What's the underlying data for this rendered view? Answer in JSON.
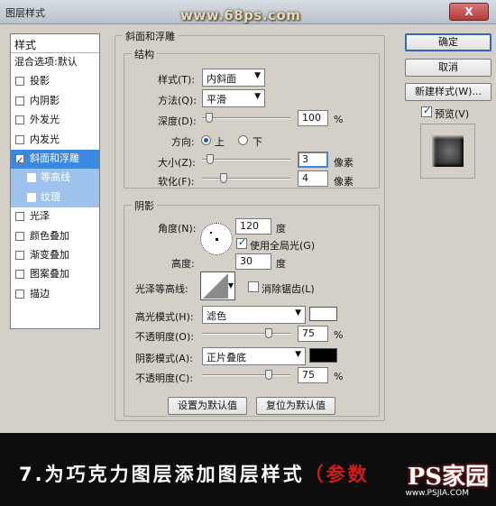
{
  "window": {
    "title": "图层样式",
    "watermark": "www.68ps.com",
    "close_label": "X"
  },
  "styles_panel": {
    "header": "样式",
    "blend_options": "混合选项:默认",
    "items": [
      {
        "label": "投影",
        "checked": false
      },
      {
        "label": "内阴影",
        "checked": false
      },
      {
        "label": "外发光",
        "checked": false
      },
      {
        "label": "内发光",
        "checked": false
      },
      {
        "label": "斜面和浮雕",
        "checked": true,
        "selected": true
      },
      {
        "label": "等高线",
        "checked": false,
        "sub": true
      },
      {
        "label": "纹理",
        "checked": false,
        "sub": true
      },
      {
        "label": "光泽",
        "checked": false
      },
      {
        "label": "颜色叠加",
        "checked": false
      },
      {
        "label": "渐变叠加",
        "checked": false
      },
      {
        "label": "图案叠加",
        "checked": false
      },
      {
        "label": "描边",
        "checked": false
      }
    ]
  },
  "bevel": {
    "group_title": "斜面和浮雕",
    "structure_title": "结构",
    "style_label": "样式(T):",
    "style_value": "内斜面",
    "technique_label": "方法(Q):",
    "technique_value": "平滑",
    "depth_label": "深度(D):",
    "depth_value": "100",
    "depth_unit": "%",
    "depth_pct": 0.0,
    "direction_label": "方向:",
    "dir_up": "上",
    "dir_down": "下",
    "size_label": "大小(Z):",
    "size_value": "3",
    "size_unit": "像素",
    "soften_label": "软化(F):",
    "soften_value": "4",
    "soften_unit": "像素"
  },
  "shading": {
    "title": "阴影",
    "angle_label": "角度(N):",
    "angle_value": "120",
    "angle_unit": "度",
    "global_light_label": "使用全局光(G)",
    "global_light_checked": true,
    "altitude_label": "高度:",
    "altitude_value": "30",
    "altitude_unit": "度",
    "gloss_contour_label": "光泽等高线:",
    "anti_alias_label": "消除锯齿(L)",
    "anti_alias_checked": false,
    "highlight_mode_label": "高光模式(H):",
    "highlight_mode_value": "滤色",
    "highlight_color": "#ffffff",
    "highlight_opacity_label": "不透明度(O):",
    "highlight_opacity_value": "75",
    "highlight_opacity_unit": "%",
    "shadow_mode_label": "阴影模式(A):",
    "shadow_mode_value": "正片叠底",
    "shadow_color": "#000000",
    "shadow_opacity_label": "不透明度(C):",
    "shadow_opacity_value": "75",
    "shadow_opacity_unit": "%"
  },
  "buttons": {
    "ok": "确定",
    "cancel": "取消",
    "new_style": "新建样式(W)...",
    "preview": "预览(V)",
    "preview_checked": true,
    "make_default": "设置为默认值",
    "reset_default": "复位为默认值"
  },
  "caption": {
    "text": "7.为巧克力图层添加图层样式",
    "paren": "（参数",
    "logo": "PS家园",
    "url": "www.PSJIA.COM"
  }
}
